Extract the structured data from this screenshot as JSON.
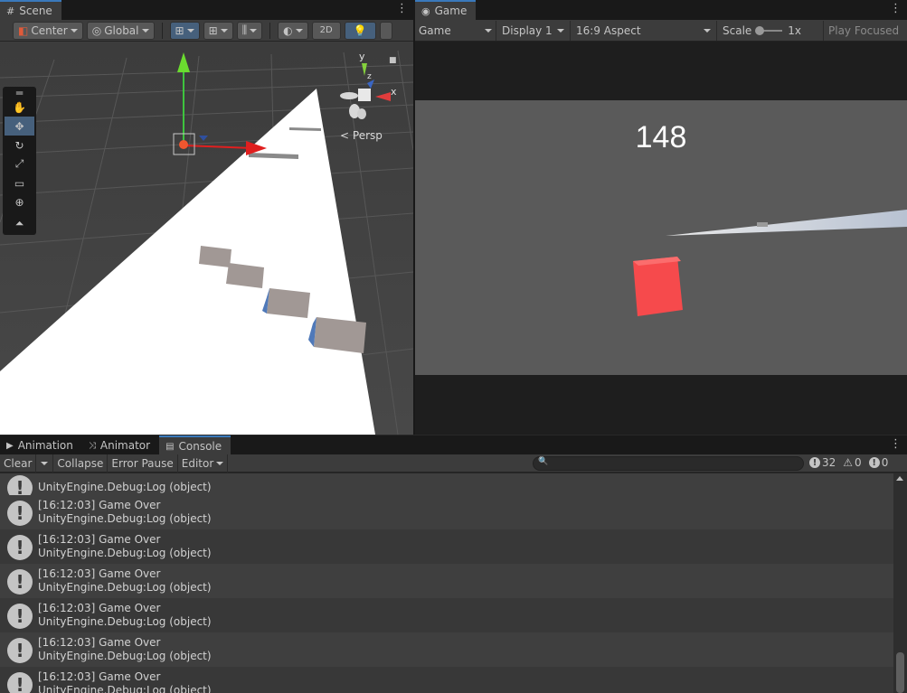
{
  "scene_panel": {
    "tab_label": "Scene",
    "pivot_label": "Center",
    "space_label": "Global",
    "mode_2d": "2D",
    "gizmo": {
      "y": "y",
      "x": "x",
      "z": "z",
      "persp_label": "Persp"
    }
  },
  "game_panel": {
    "tab_label": "Game",
    "view_select": "Game",
    "display_select": "Display 1",
    "aspect_select": "16:9 Aspect",
    "scale_label": "Scale",
    "scale_value": "1x",
    "play_mode": "Play Focused",
    "score": "148",
    "colors": {
      "player": "#f64a4c",
      "ground": "#5a5a5a"
    }
  },
  "bottom_tabs": [
    "Animation",
    "Animator",
    "Console"
  ],
  "console": {
    "clear": "Clear",
    "collapse": "Collapse",
    "error_pause": "Error Pause",
    "editor": "Editor",
    "search_placeholder": "",
    "log_count": "32",
    "warning_count": "0",
    "error_count": "0",
    "partial_top": {
      "line2": "UnityEngine.Debug:Log (object)"
    },
    "entries": [
      {
        "line1": "[16:12:03] Game Over",
        "line2": "UnityEngine.Debug:Log (object)"
      },
      {
        "line1": "[16:12:03] Game Over",
        "line2": "UnityEngine.Debug:Log (object)"
      },
      {
        "line1": "[16:12:03] Game Over",
        "line2": "UnityEngine.Debug:Log (object)"
      },
      {
        "line1": "[16:12:03] Game Over",
        "line2": "UnityEngine.Debug:Log (object)"
      },
      {
        "line1": "[16:12:03] Game Over",
        "line2": "UnityEngine.Debug:Log (object)"
      },
      {
        "line1": "[16:12:03] Game Over",
        "line2": "UnityEngine.Debug:Log (object)"
      }
    ]
  }
}
